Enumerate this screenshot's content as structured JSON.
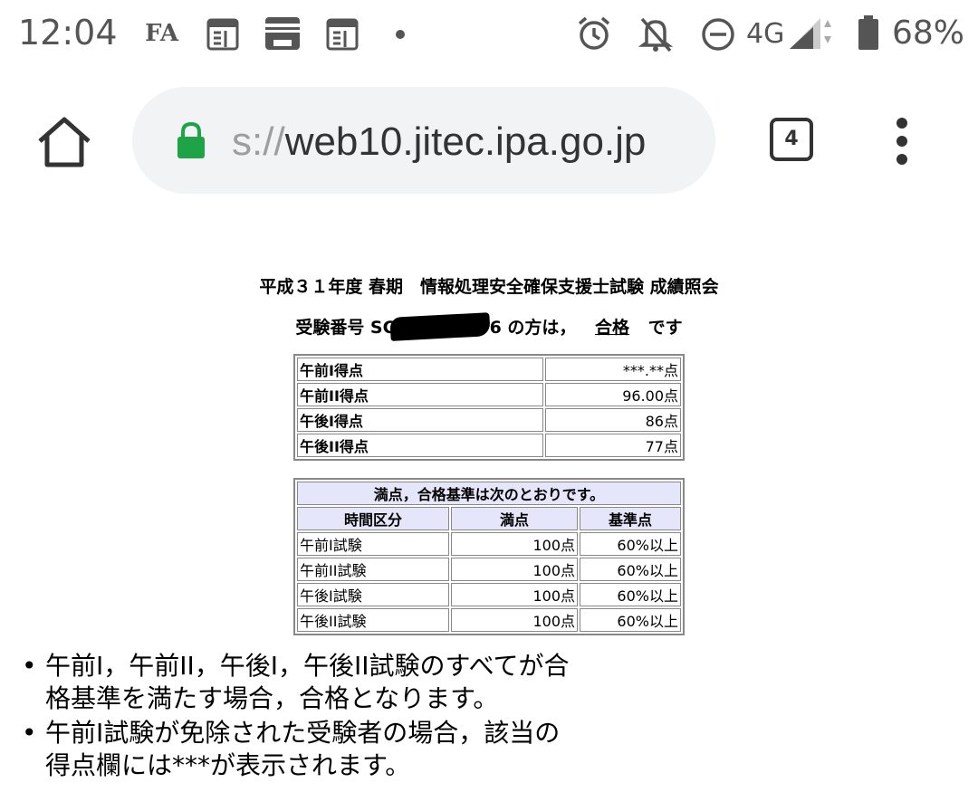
{
  "status_bar": {
    "time": "12:04",
    "notif_fa": "FA",
    "notif_icons": [
      "newspaper-icon",
      "pass-card-icon",
      "newspaper-icon",
      "dot-icon"
    ],
    "network": "4G",
    "battery": "68%",
    "right_icons": [
      "alarm-icon",
      "bell-off-icon",
      "do-not-disturb-icon",
      "signal-icon",
      "battery-icon"
    ]
  },
  "browser": {
    "url_scheme": "s://",
    "url_host": "web10.jitec.ipa.go.jp",
    "tab_count": "4",
    "lock_color": "#1ea446"
  },
  "page": {
    "title": "平成３１年度 春期　情報処理安全確保支援士試験 成績照会",
    "result_prefix": "受験番号 SC",
    "result_suffix": "6 の方は，",
    "result_status": "合格",
    "result_end": "です",
    "scores": [
      {
        "label": "午前I得点",
        "value": "***.**点"
      },
      {
        "label": "午前II得点",
        "value": "96.00点"
      },
      {
        "label": "午後I得点",
        "value": "86点"
      },
      {
        "label": "午後II得点",
        "value": "77点"
      }
    ],
    "criteria_caption": "満点，合格基準は次のとおりです。",
    "criteria_headers": [
      "時間区分",
      "満点",
      "基準点"
    ],
    "criteria_rows": [
      [
        "午前I試験",
        "100点",
        "60%以上"
      ],
      [
        "午前II試験",
        "100点",
        "60%以上"
      ],
      [
        "午後I試験",
        "100点",
        "60%以上"
      ],
      [
        "午後II試験",
        "100点",
        "60%以上"
      ]
    ],
    "notes": [
      "午前I，午前II，午後I，午後II試験のすべてが合格基準を満たす場合，合格となります。",
      "午前I試験が免除された受験者の場合，該当の得点欄には***が表示されます。"
    ]
  }
}
